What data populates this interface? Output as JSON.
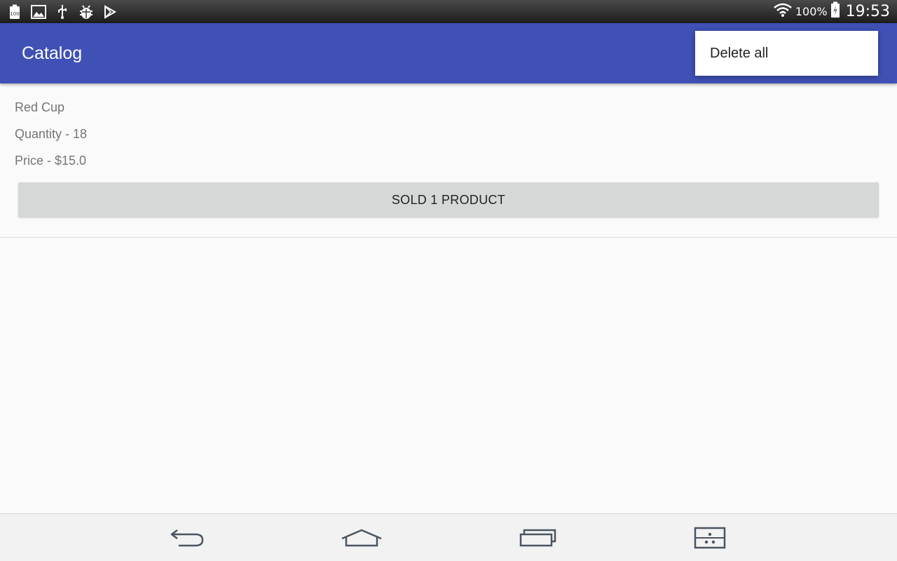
{
  "status_bar": {
    "battery_percent": "100%",
    "time": "19:53",
    "left_icons": [
      "battery-100-icon",
      "image-icon",
      "usb-icon",
      "android-debug-icon",
      "play-store-icon"
    ],
    "right_icons": [
      "wifi-icon",
      "battery-charging-icon"
    ]
  },
  "app_bar": {
    "title": "Catalog",
    "color": "#3f51b5"
  },
  "overflow_menu": {
    "items": [
      {
        "label": "Delete all"
      }
    ]
  },
  "products": [
    {
      "name": "Red Cup",
      "quantity": "Quantity - 18",
      "price": "Price - $15.0",
      "button_label": "SOLD 1 PRODUCT"
    }
  ],
  "nav_bar": {
    "buttons": [
      "back-icon",
      "home-icon",
      "recent-apps-icon",
      "multi-window-icon"
    ]
  }
}
